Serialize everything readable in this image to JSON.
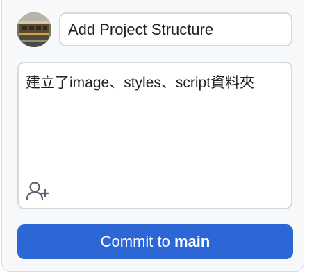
{
  "commit": {
    "summary_value": "Add Project Structure",
    "description_value": "建立了image、styles、script資料夾",
    "button_prefix": "Commit to",
    "branch": "main"
  },
  "icons": {
    "avatar": "user-avatar-photo",
    "coauthor": "person-add-icon"
  },
  "colors": {
    "commit_button": "#2d67d5",
    "panel_background": "#f6f8fa",
    "border": "#d7dadd",
    "icon_gray": "#59636e"
  }
}
